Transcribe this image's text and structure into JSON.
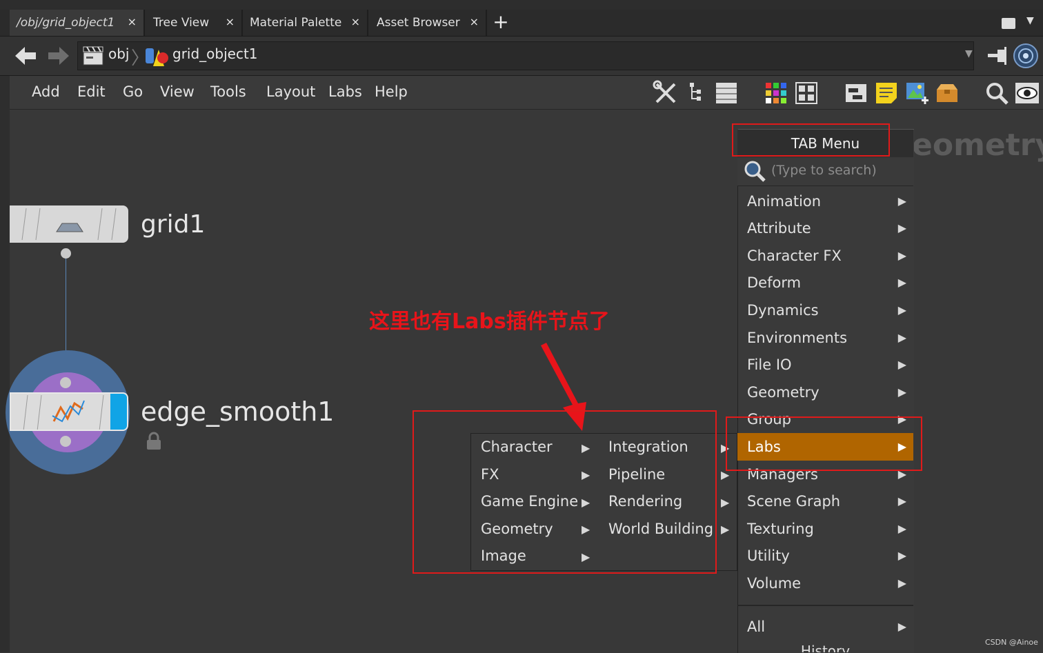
{
  "tabs": [
    {
      "label": "/obj/grid_object1",
      "active": true
    },
    {
      "label": "Tree View",
      "active": false
    },
    {
      "label": "Material Palette",
      "active": false
    },
    {
      "label": "Asset Browser",
      "active": false
    }
  ],
  "tab_close_glyph": "×",
  "add_tab_glyph": "+",
  "path": {
    "obj": "obj",
    "object": "grid_object1"
  },
  "menus": [
    "Add",
    "Edit",
    "Go",
    "View",
    "Tools",
    "Layout",
    "Labs",
    "Help"
  ],
  "toolbar_icons": [
    "wrench-icon",
    "tree-icon",
    "list-icon",
    "color-grid-icon",
    "thumbnail-icon",
    "network-box-icon",
    "sticky-note-icon",
    "image-add-icon",
    "package-icon",
    "search-icon",
    "eye-icon"
  ],
  "nodes": {
    "grid": {
      "name": "grid1"
    },
    "edge": {
      "name": "edge_smooth1"
    }
  },
  "background_context": "eometry",
  "annotation": "这里也有Labs插件节点了",
  "tab_menu": {
    "title": "TAB Menu",
    "search_placeholder": "(Type to search)",
    "items": [
      {
        "label": "Animation"
      },
      {
        "label": "Attribute"
      },
      {
        "label": "Character FX"
      },
      {
        "label": "Deform"
      },
      {
        "label": "Dynamics"
      },
      {
        "label": "Environments"
      },
      {
        "label": "File IO"
      },
      {
        "label": "Geometry"
      },
      {
        "label": "Group"
      },
      {
        "label": "Labs",
        "selected": true
      },
      {
        "label": "Managers"
      },
      {
        "label": "Scene Graph"
      },
      {
        "label": "Texturing"
      },
      {
        "label": "Utility"
      },
      {
        "label": "Volume"
      }
    ],
    "all_label": "All",
    "history_label": "History"
  },
  "labs_submenu": {
    "col1": [
      "Character",
      "FX",
      "Game Engine",
      "Geometry",
      "Image"
    ],
    "col2": [
      "Integration",
      "Pipeline",
      "Rendering",
      "World Building"
    ]
  },
  "arrow_glyph": "▶",
  "colors": {
    "selected": "#b06500",
    "annotation_red": "#e01a1a",
    "node_blue_flag": "#10a4e6",
    "ring_outer": "#496d99",
    "ring_inner": "#9b6fc7"
  },
  "watermark": "CSDN @Ainoe"
}
